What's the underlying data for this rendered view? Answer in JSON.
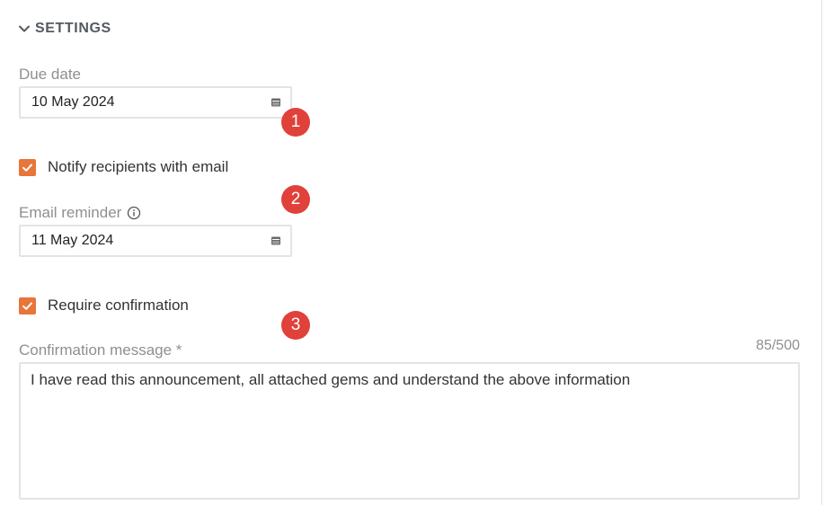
{
  "section": {
    "title": "SETTINGS",
    "toggle_icon": "chevron-down-icon"
  },
  "due_date": {
    "label": "Due date",
    "value": "10 May 2024",
    "icon": "calendar-icon"
  },
  "notify": {
    "label": "Notify recipients with email",
    "checked": true
  },
  "email_reminder": {
    "label": "Email reminder",
    "info_icon": "info-icon",
    "value": "11 May 2024",
    "icon": "calendar-icon"
  },
  "require_confirmation": {
    "label": "Require confirmation",
    "checked": true
  },
  "confirmation_message": {
    "label": "Confirmation message *",
    "counter": "85/500",
    "value": "I have read this announcement, all attached gems and understand the above information"
  },
  "annotations": [
    "1",
    "2",
    "3"
  ],
  "colors": {
    "checkbox": "#e8753a",
    "badge": "#e0413a",
    "label": "#8f8f8f",
    "header": "#555a60"
  }
}
